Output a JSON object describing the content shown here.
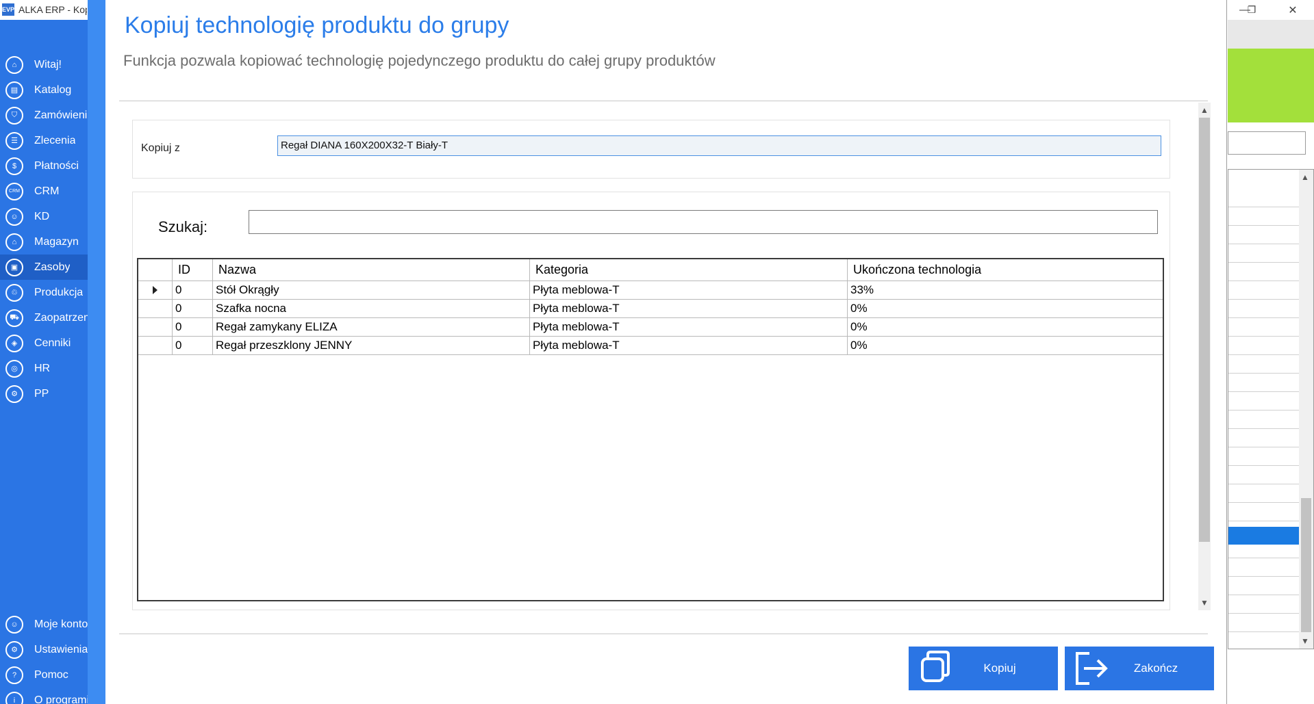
{
  "app": {
    "logo": "EVP",
    "title": "ALKA ERP - Kopiuj"
  },
  "window_controls": [
    "—",
    "❐",
    "✕"
  ],
  "sidebar": {
    "items": [
      {
        "label": "Witaj!",
        "icon": "home-icon"
      },
      {
        "label": "Katalog",
        "icon": "book-icon"
      },
      {
        "label": "Zamówienia",
        "icon": "cart-icon"
      },
      {
        "label": "Zlecenia",
        "icon": "list-icon"
      },
      {
        "label": "Płatności",
        "icon": "dollar-icon"
      },
      {
        "label": "CRM",
        "icon": "crm-icon"
      },
      {
        "label": "KD",
        "icon": "person-icon"
      },
      {
        "label": "Magazyn",
        "icon": "warehouse-icon"
      },
      {
        "label": "Zasoby",
        "icon": "resources-icon"
      },
      {
        "label": "Produkcja",
        "icon": "production-icon"
      },
      {
        "label": "Zaopatrzenie",
        "icon": "truck-icon"
      },
      {
        "label": "Cenniki",
        "icon": "tag-icon"
      },
      {
        "label": "HR",
        "icon": "hr-icon"
      },
      {
        "label": "PP",
        "icon": "pp-icon"
      }
    ],
    "bottom_items": [
      {
        "label": "Moje konto",
        "icon": "user-icon"
      },
      {
        "label": "Ustawienia",
        "icon": "gear-icon"
      },
      {
        "label": "Pomoc",
        "icon": "help-icon"
      },
      {
        "label": "O programie",
        "icon": "info-icon"
      }
    ],
    "active": "Zasoby"
  },
  "dialog": {
    "title": "Kopiuj technologię produktu do grupy",
    "subtitle": "Funkcja pozwala kopiować technologię pojedynczego produktu do całej grupy produktów",
    "copy_from": {
      "label": "Kopiuj z",
      "value": "Regał DIANA 160X200X32-T Biały-T"
    },
    "search": {
      "label": "Szukaj:",
      "value": ""
    },
    "table": {
      "columns": [
        "ID",
        "Nazwa",
        "Kategoria",
        "Ukończona technologia"
      ],
      "rows": [
        {
          "id": "0",
          "name": "Stół Okrągły",
          "category": "Płyta meblowa-T",
          "completed": "33%"
        },
        {
          "id": "0",
          "name": "Szafka nocna",
          "category": "Płyta meblowa-T",
          "completed": "0%"
        },
        {
          "id": "0",
          "name": "Regał zamykany ELIZA",
          "category": "Płyta meblowa-T",
          "completed": "0%"
        },
        {
          "id": "0",
          "name": "Regał przeszklony JENNY",
          "category": "Płyta meblowa-T",
          "completed": "0%"
        }
      ]
    },
    "buttons": {
      "copy": "Kopiuj",
      "close": "Zakończ"
    }
  },
  "colors": {
    "sidebar": "#2b75e4",
    "accent": "#2b7de9",
    "button": "#2b75e4",
    "green": "#a3e03b",
    "selection": "#1a7be2"
  }
}
